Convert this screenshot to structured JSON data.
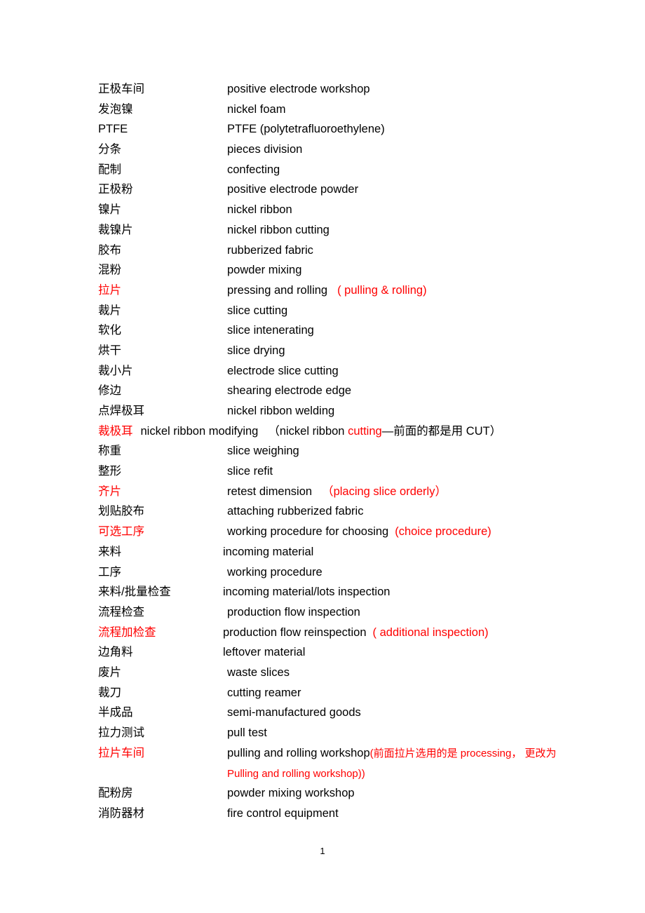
{
  "document": {
    "page_number": "1",
    "accent_color": "#ff0000",
    "text_color": "#000000",
    "rows": [
      {
        "term": "正极车间",
        "gloss": "positive electrode workshop"
      },
      {
        "term": "发泡镍",
        "gloss": "nickel foam"
      },
      {
        "term": "PTFE",
        "gloss": "PTFE (polytetrafluoroethylene)"
      },
      {
        "term": "分条",
        "gloss": "pieces division"
      },
      {
        "term": "配制",
        "gloss": "confecting"
      },
      {
        "term": "正极粉",
        "gloss": "positive electrode powder"
      },
      {
        "term": "镍片",
        "gloss": "nickel ribbon"
      },
      {
        "term": "裁镍片",
        "gloss": "nickel ribbon cutting"
      },
      {
        "term": "胶布",
        "gloss": "rubberized fabric"
      },
      {
        "term": "混粉",
        "gloss": "powder mixing"
      },
      {
        "term": "拉片",
        "term_red": true,
        "gloss": "pressing and rolling",
        "note": "( pulling & rolling)",
        "note_red": true
      },
      {
        "term": "裁片",
        "gloss": "slice cutting"
      },
      {
        "term": "软化",
        "gloss": "slice intenerating"
      },
      {
        "term": "烘干",
        "gloss": "slice drying"
      },
      {
        "term": "裁小片",
        "gloss": "electrode slice cutting"
      },
      {
        "term": "修边",
        "gloss": "shearing electrode edge"
      },
      {
        "term": "点焊极耳",
        "gloss": "nickel ribbon welding"
      },
      {
        "term": "裁极耳",
        "term_red": true,
        "flow": true,
        "gloss": "nickel ribbon modifying",
        "note_parts": [
          {
            "text": "（nickel ribbon ",
            "red": false
          },
          {
            "text": "cutting",
            "red": true
          },
          {
            "text": "—前面的都是用 CUT）",
            "red": false
          }
        ]
      },
      {
        "term": "称重",
        "gloss": "slice weighing"
      },
      {
        "term": "整形",
        "gloss": "slice refit"
      },
      {
        "term": "齐片",
        "term_red": true,
        "gloss": "retest dimension",
        "note": "（placing slice orderly）",
        "note_red": true
      },
      {
        "term": "划贴胶布",
        "gloss": "attaching rubberized fabric"
      },
      {
        "term": "可选工序",
        "term_red": true,
        "gloss": "working procedure for choosing",
        "note": "(choice procedure)",
        "note_red": true,
        "tight": true
      },
      {
        "term": "来料",
        "gloss": "incoming material",
        "shift": true
      },
      {
        "term": "工序",
        "gloss": "working procedure"
      },
      {
        "term": "来料/批量检查",
        "gloss": "incoming material/lots inspection",
        "shift": true
      },
      {
        "term": "流程检查",
        "gloss": "production flow inspection"
      },
      {
        "term": "流程加检查",
        "term_red": true,
        "gloss": "production flow reinspection",
        "note": "( additional inspection)",
        "note_red": true,
        "shift": true,
        "tight": true
      },
      {
        "term": "边角料",
        "gloss": "leftover material",
        "shift": true
      },
      {
        "term": "废片",
        "gloss": "waste slices"
      },
      {
        "term": "裁刀",
        "gloss": "cutting reamer"
      },
      {
        "term": "半成品",
        "gloss": "semi-manufactured goods"
      },
      {
        "term": "拉力测试",
        "gloss": "pull test"
      },
      {
        "term": "拉片车间",
        "term_red": true,
        "tall": true,
        "shift": true,
        "gloss": "pulling and rolling workshop",
        "note_parts": [
          {
            "text": "(前面拉片选用的是 processing， 更改为 Pulling and rolling workshop))",
            "red": true,
            "small": true
          }
        ]
      },
      {
        "term": "配粉房",
        "gloss": "powder mixing workshop"
      },
      {
        "term": "消防器材",
        "gloss": "fire control equipment"
      }
    ]
  }
}
